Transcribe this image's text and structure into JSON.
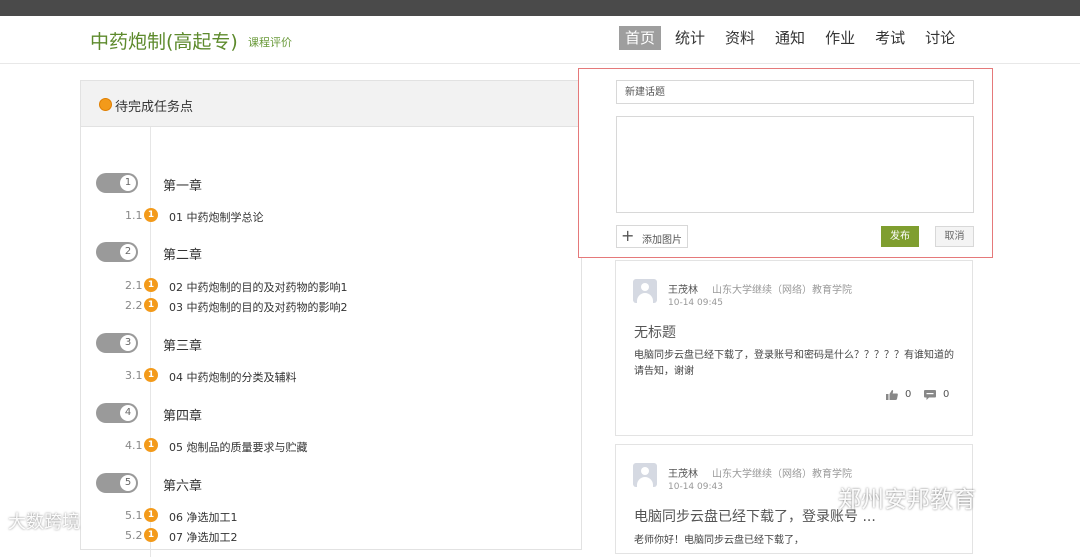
{
  "header": {
    "course_title": "中药炮制(高起专)",
    "course_subtitle": "课程评价",
    "nav": [
      {
        "label": "首页",
        "active": true
      },
      {
        "label": "统计",
        "active": false
      },
      {
        "label": "资料",
        "active": false
      },
      {
        "label": "通知",
        "active": false
      },
      {
        "label": "作业",
        "active": false
      },
      {
        "label": "考试",
        "active": false
      },
      {
        "label": "讨论",
        "active": false
      }
    ]
  },
  "tasks": {
    "title": "待完成任务点",
    "chapters": [
      {
        "num": "1",
        "label": "第一章",
        "lessons": [
          {
            "num": "1.1",
            "badge": "1",
            "label": "01 中药炮制学总论"
          }
        ]
      },
      {
        "num": "2",
        "label": "第二章",
        "lessons": [
          {
            "num": "2.1",
            "badge": "1",
            "label": "02 中药炮制的目的及对药物的影响1"
          },
          {
            "num": "2.2",
            "badge": "1",
            "label": "03 中药炮制的目的及对药物的影响2"
          }
        ]
      },
      {
        "num": "3",
        "label": "第三章",
        "lessons": [
          {
            "num": "3.1",
            "badge": "1",
            "label": "04 中药炮制的分类及辅料"
          }
        ]
      },
      {
        "num": "4",
        "label": "第四章",
        "lessons": [
          {
            "num": "4.1",
            "badge": "1",
            "label": "05 炮制品的质量要求与贮藏"
          }
        ]
      },
      {
        "num": "5",
        "label": "第六章",
        "lessons": [
          {
            "num": "5.1",
            "badge": "1",
            "label": "06 净选加工1"
          },
          {
            "num": "5.2",
            "badge": "1",
            "label": "07 净选加工2"
          }
        ]
      }
    ]
  },
  "compose": {
    "topic_placeholder": "新建话题",
    "add_image_label": "添加图片",
    "publish_label": "发布",
    "cancel_label": "取消"
  },
  "posts": [
    {
      "author": "王茂林",
      "org": "山东大学继续（网络）教育学院",
      "time": "10-14 09:45",
      "title": "无标题",
      "body": "电脑同步云盘已经下载了，登录账号和密码是什么？？？？？有谁知道的请告知，谢谢",
      "likes": "0",
      "comments": "0"
    },
    {
      "author": "王茂林",
      "org": "山东大学继续（网络）教育学院",
      "time": "10-14 09:43",
      "title": "电脑同步云盘已经下载了，登录账号 ...",
      "body": "老师你好！电脑同步云盘已经下载了，"
    }
  ],
  "watermarks": {
    "left": "大数跨境",
    "right": "郑州安邦教育"
  },
  "colors": {
    "accent_green": "#7f9e2f",
    "orange": "#f39a1a",
    "highlight_border": "#e5797a"
  }
}
